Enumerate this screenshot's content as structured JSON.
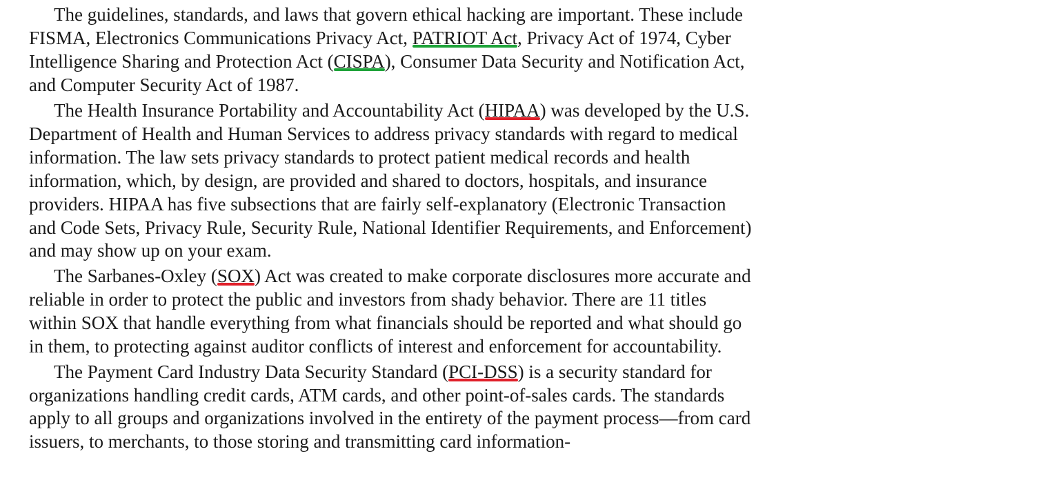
{
  "doc": {
    "p1": {
      "l1": "The guidelines, standards, and laws that govern ethical hacking are important. These include",
      "l2a": "FISMA, Electronics Communications Privacy Act, ",
      "l2mark": "PATRIOT Act",
      "l2b": ", Privacy Act of 1974, Cyber",
      "l3a": "Intelligence Sharing and Protection Act (",
      "l3mark": "CISPA",
      "l3b": "), Consumer Data Security and Notification Act,",
      "l4": "and Computer Security Act of 1987."
    },
    "p2": {
      "l1a": "The Health Insurance Portability and Accountability Act (",
      "l1mark": "HIPAA",
      "l1b": ") was developed by the U.S.",
      "l2": "Department of Health and Human Services to address privacy standards with regard to medical",
      "l3": "information. The law sets privacy standards to protect patient medical records and health",
      "l4": "information, which, by design, are provided and shared to doctors, hospitals, and insurance",
      "l5": "providers. HIPAA has five subsections that are fairly self-explanatory (Electronic Transaction",
      "l6": "and Code Sets, Privacy Rule, Security Rule, National Identifier Requirements, and Enforcement)",
      "l7": "and may show up on your exam."
    },
    "p3": {
      "l1a": "The Sarbanes-Oxley (",
      "l1mark": "SOX",
      "l1b": ") Act was created to make corporate disclosures more accurate and",
      "l2": "reliable in order to protect the public and investors from shady behavior. There are 11 titles",
      "l3": "within SOX that handle everything from what financials should be reported and what should go",
      "l4": "in them, to protecting against auditor conflicts of interest and enforcement for accountability."
    },
    "p4": {
      "l1a": "The Payment Card Industry Data Security Standard (",
      "l1mark": "PCI-DSS",
      "l1b": ") is a security standard for",
      "l2": "organizations handling credit cards, ATM cards, and other point-of-sales cards. The standards",
      "l3": "apply to all groups and organizations involved in the entirety of the payment process—from card",
      "l4": "issuers, to merchants, to those storing and transmitting card information-"
    }
  },
  "colors": {
    "grammar_mark": "#1fa33a",
    "spelling_mark": "#e0202a",
    "text": "#1a1a1a",
    "background": "#ffffff"
  }
}
